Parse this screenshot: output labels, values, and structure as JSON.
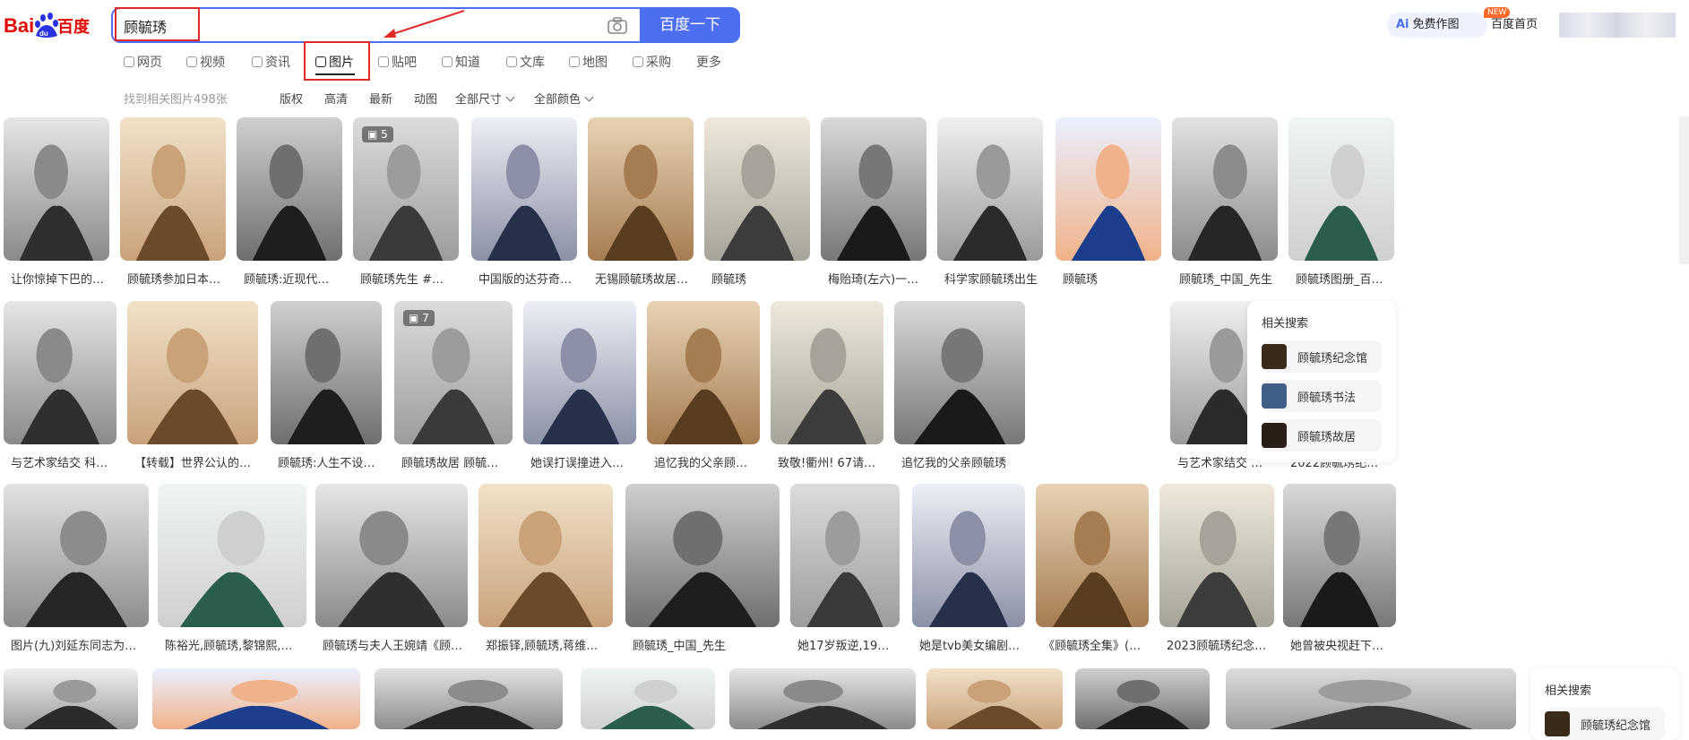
{
  "search": {
    "query": "顾毓琇",
    "button": "百度一下"
  },
  "header": {
    "ai_label": "免费作图",
    "ai_prefix": "Ai",
    "new_badge": "NEW",
    "home": "百度首页"
  },
  "tabs": [
    "网页",
    "视频",
    "资讯",
    "图片",
    "贴吧",
    "知道",
    "文库",
    "地图",
    "采购",
    "更多"
  ],
  "active_tab": "图片",
  "result_count": "找到相关图片498张",
  "filters": [
    "版权",
    "高清",
    "最新",
    "动图",
    "全部尺寸",
    "全部颜色"
  ],
  "rows": [
    [
      {
        "caption": "让你惊掉下巴的中..."
      },
      {
        "caption": "顾毓琇参加日本受..."
      },
      {
        "caption": "顾毓琇:近现代中国..."
      },
      {
        "caption": "顾毓琇先生 #传奇...",
        "badge": "5"
      },
      {
        "caption": "中国版的达芬奇—..."
      },
      {
        "caption": "无锡顾毓琇故居(顾..."
      },
      {
        "caption": "顾毓琇"
      },
      {
        "caption": "梅贻琦(左六)一家..."
      },
      {
        "caption": "科学家顾毓琇出生"
      },
      {
        "caption": "顾毓琇"
      },
      {
        "caption": "顾毓琇_中国_先生"
      },
      {
        "caption": "顾毓琇图册_百度百科"
      }
    ],
    [
      {
        "caption": "与艺术家结交 科学家..."
      },
      {
        "caption": "【转载】世界公认的大师..."
      },
      {
        "caption": "顾毓琇:人生不设限,..."
      },
      {
        "caption": "顾毓琇故居 顾毓琇(19...",
        "badge": "7"
      },
      {
        "caption": "她误打误撞进入娱乐..."
      },
      {
        "caption": "追忆我的父亲顾毓琇"
      },
      {
        "caption": "致敬!衢州! 67请记住..."
      },
      {
        "caption": "追忆我的父亲顾毓琇"
      },
      {
        "caption": "与艺术家结交 科..."
      },
      {
        "caption": "2022顾毓琇纪念馆游..."
      }
    ],
    [
      {
        "caption": "图片(九)刘延东同志为顾毓..."
      },
      {
        "caption": "陈裕光,顾毓琇,黎锦熙,顾颉刚..."
      },
      {
        "caption": "顾毓琇与夫人王婉靖《顾毓琇..."
      },
      {
        "caption": "郑振铎,顾毓琇,蒋维乔等 ..."
      },
      {
        "caption": "顾毓琇_中国_先生"
      },
      {
        "caption": "她17岁叛逆,19岁与..."
      },
      {
        "caption": "她是tvb美女编剧,转..."
      },
      {
        "caption": "《顾毓琇全集》(1,2,..."
      },
      {
        "caption": "2023顾毓琇纪念馆游..."
      },
      {
        "caption": "她曾被央视赶下舞台,..."
      }
    ],
    [
      {},
      {},
      {},
      {},
      {},
      {},
      {},
      {}
    ]
  ],
  "related": {
    "title": "相关搜索",
    "items": [
      "顾毓琇纪念馆",
      "顾毓琇书法",
      "顾毓琇故居"
    ]
  },
  "related_bottom": {
    "title": "相关搜索",
    "items": [
      "顾毓琇纪念馆"
    ]
  }
}
